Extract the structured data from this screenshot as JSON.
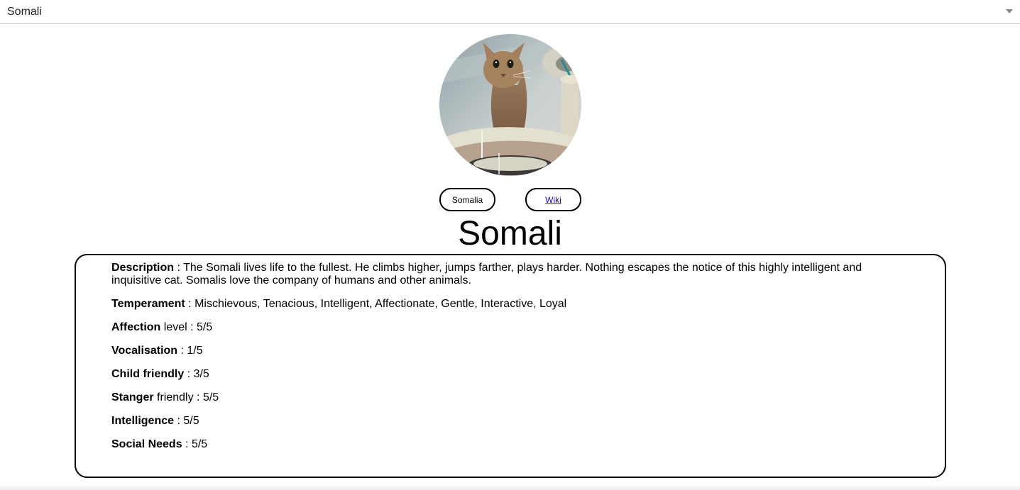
{
  "breed_select": {
    "selected": "Somali"
  },
  "photo": {
    "alt": "Somali cat"
  },
  "buttons": {
    "origin_label": "Somalia",
    "wiki_label": "Wiki"
  },
  "breed_name": "Somali",
  "details": {
    "description_key": "Description",
    "description_value": " : The Somali lives life to the fullest. He climbs higher, jumps farther, plays harder. Nothing escapes the notice of this highly intelligent and inquisitive cat. Somalis love the company of humans and other animals.",
    "temperament_key": "Temperament",
    "temperament_value": " : Mischievous, Tenacious, Intelligent, Affectionate, Gentle, Interactive, Loyal",
    "affection_key": "Affection",
    "affection_value": " level : 5/5",
    "vocalisation_key": "Vocalisation",
    "vocalisation_value": " : 1/5",
    "child_key": "Child friendly",
    "child_value": " : 3/5",
    "stranger_key": "Stanger",
    "stranger_value": " friendly : 5/5",
    "intelligence_key": "Intelligence",
    "intelligence_value": " : 5/5",
    "social_key": "Social Needs",
    "social_value": " : 5/5"
  }
}
